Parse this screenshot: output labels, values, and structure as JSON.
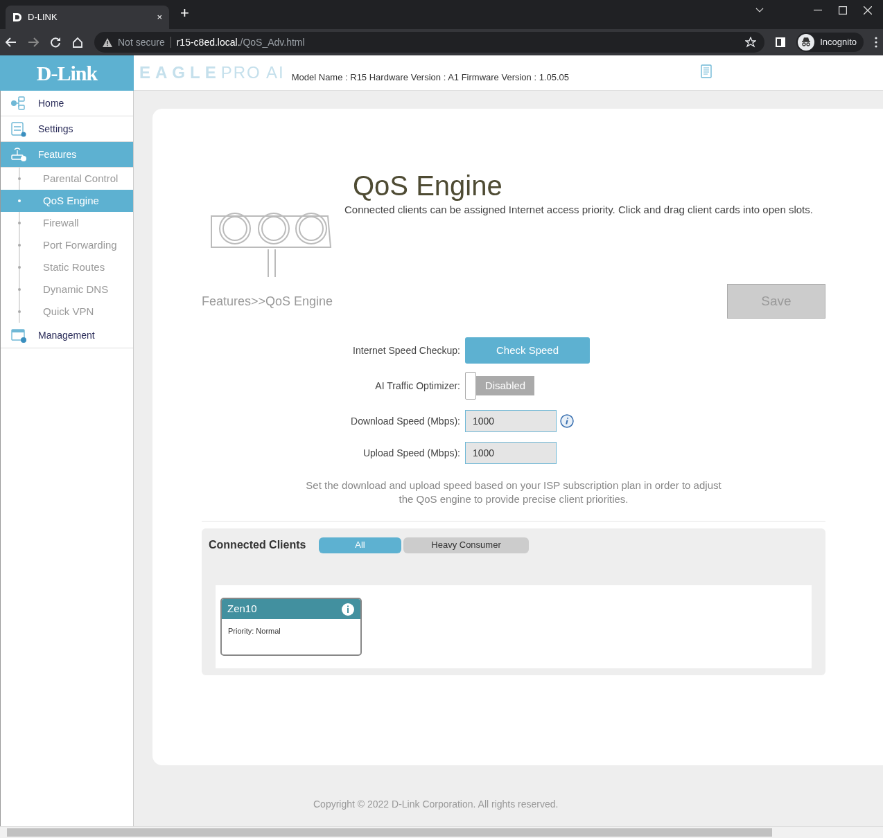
{
  "browser": {
    "tab_title": "D-LINK",
    "tab_close": "×",
    "new_tab": "+",
    "security": "Not secure",
    "host": "r15-c8ed.local.",
    "path": "/QoS_Adv.html",
    "profile": "Incognito"
  },
  "header": {
    "logo": "D-Link",
    "brand_bold": "EAGLE",
    "brand_light": "PRO AI",
    "info": "Model Name : R15 Hardware Version : A1 Firmware Version : 1.05.05"
  },
  "sidebar": {
    "items": [
      {
        "label": "Home",
        "kind": "home",
        "selected": false
      },
      {
        "label": "Settings",
        "kind": "settings",
        "selected": false
      },
      {
        "label": "Features",
        "kind": "features",
        "selected": true,
        "children": [
          {
            "label": "Parental Control",
            "selected": false
          },
          {
            "label": "QoS Engine",
            "selected": true
          },
          {
            "label": "Firewall",
            "selected": false
          },
          {
            "label": "Port Forwarding",
            "selected": false
          },
          {
            "label": "Static Routes",
            "selected": false
          },
          {
            "label": "Dynamic DNS",
            "selected": false
          },
          {
            "label": "Quick VPN",
            "selected": false
          }
        ]
      },
      {
        "label": "Management",
        "kind": "management",
        "selected": false
      }
    ]
  },
  "page": {
    "title": "QoS Engine",
    "description": "Connected clients can be assigned Internet access priority. Click and drag client cards into open slots.",
    "breadcrumb": "Features>>QoS Engine",
    "save": {
      "label": "Save",
      "disabled": true
    }
  },
  "settings": [
    {
      "kind": "button",
      "label": "Internet Speed Checkup:",
      "button": "Check Speed"
    },
    {
      "kind": "toggle",
      "label": "AI Traffic Optimizer:",
      "state_text": "Disabled",
      "on": false
    },
    {
      "kind": "input",
      "label": "Download Speed (Mbps):",
      "value": "1000",
      "info": true
    },
    {
      "kind": "input",
      "label": "Upload Speed (Mbps):",
      "value": "1000",
      "info": false
    }
  ],
  "note": "Set the download and upload speed based on your ISP subscription plan in order to adjust the QoS engine to provide precise client priorities.",
  "clients": {
    "title": "Connected Clients",
    "filters": [
      {
        "label": "All",
        "selected": true
      },
      {
        "label": "Heavy Consumer",
        "selected": false
      }
    ],
    "cards": [
      {
        "name": "Zen10",
        "priority": "Priority: Normal"
      }
    ]
  },
  "footer": "Copyright © 2022 D-Link Corporation. All rights reserved."
}
